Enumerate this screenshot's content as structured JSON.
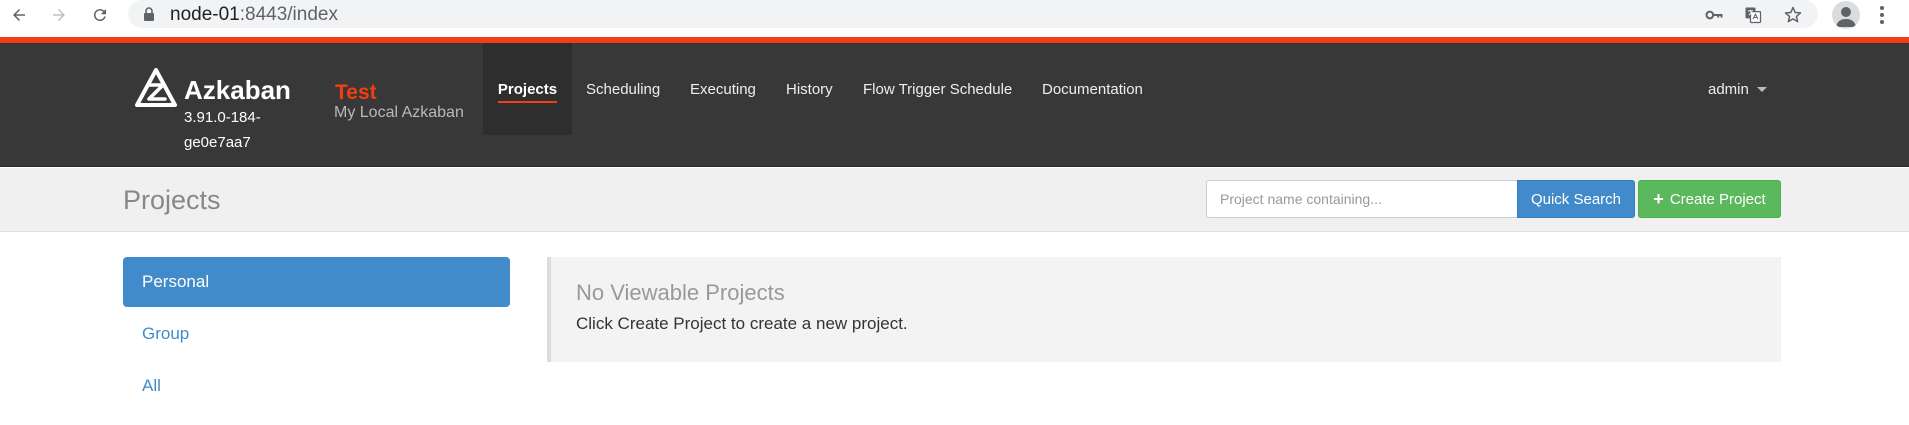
{
  "browser": {
    "url_host": "node-01",
    "url_rest": ":8443/index"
  },
  "header": {
    "brand": "Azkaban",
    "version": "3.91.0-184-ge0e7aa7",
    "env_name": "Test",
    "env_desc": "My Local Azkaban",
    "nav": [
      {
        "label": "Projects",
        "active": true
      },
      {
        "label": "Scheduling"
      },
      {
        "label": "Executing"
      },
      {
        "label": "History"
      },
      {
        "label": "Flow Trigger Schedule"
      },
      {
        "label": "Documentation"
      }
    ],
    "user": "admin"
  },
  "subheader": {
    "title": "Projects",
    "search_placeholder": "Project name containing...",
    "search_button": "Quick Search",
    "create_button": "Create Project"
  },
  "sidebar": {
    "items": [
      {
        "label": "Personal",
        "active": true
      },
      {
        "label": "Group"
      },
      {
        "label": "All"
      }
    ]
  },
  "main": {
    "empty_title": "No Viewable Projects",
    "empty_text": "Click Create Project to create a new project."
  },
  "colors": {
    "accent": "#f33e12",
    "navbar": "#383838",
    "primary": "#428bca",
    "success": "#5cb85c"
  }
}
